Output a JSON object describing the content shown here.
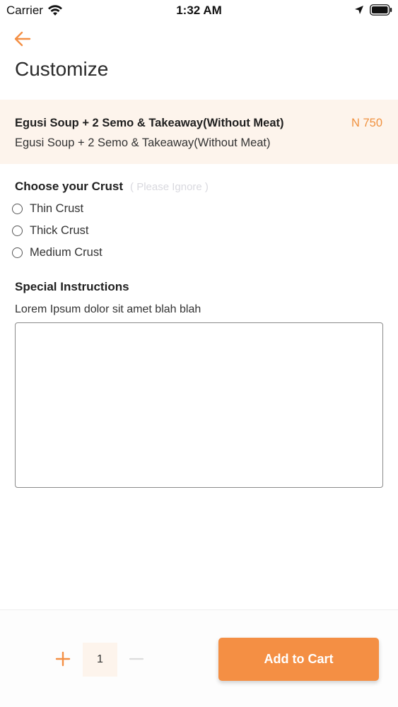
{
  "status_bar": {
    "carrier": "Carrier",
    "time": "1:32 AM"
  },
  "header": {
    "title": "Customize"
  },
  "product": {
    "name": "Egusi Soup + 2 Semo & Takeaway(Without Meat)",
    "price": "N 750",
    "description": "Egusi Soup + 2 Semo & Takeaway(Without Meat)"
  },
  "crust": {
    "title": "Choose your Crust",
    "hint": "( Please Ignore )",
    "options": [
      {
        "label": "Thin Crust"
      },
      {
        "label": "Thick Crust"
      },
      {
        "label": "Medium Crust"
      }
    ]
  },
  "instructions": {
    "title": "Special Instructions",
    "subtitle": "Lorem Ipsum dolor sit amet blah blah",
    "value": ""
  },
  "cart": {
    "quantity": "1",
    "add_label": "Add to Cart"
  },
  "colors": {
    "accent": "#f48f44",
    "price": "#f0913f",
    "band": "#fdf4ec"
  },
  "icons": {
    "back": "arrow-left-icon",
    "plus": "plus-icon",
    "minus": "minus-icon",
    "wifi": "wifi-icon",
    "location": "location-arrow-icon",
    "battery": "battery-icon"
  }
}
